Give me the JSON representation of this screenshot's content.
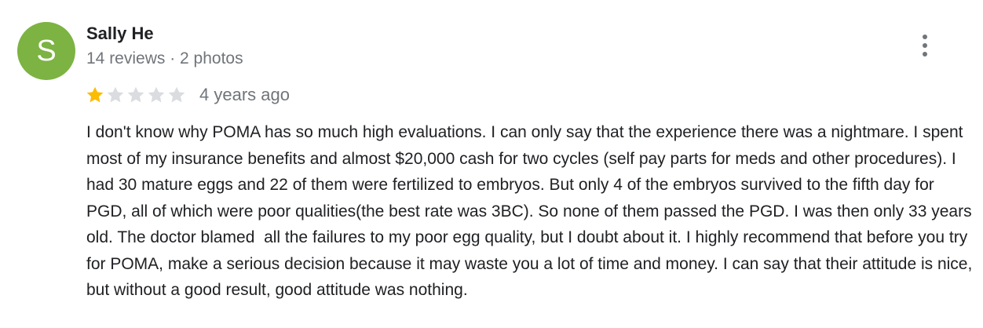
{
  "review": {
    "avatar_letter": "S",
    "avatar_color": "#7cb342",
    "author_name": "Sally He",
    "author_meta": "14 reviews · 2 photos",
    "rating": 1,
    "rating_max": 5,
    "star_filled_color": "#fbbc04",
    "star_empty_color": "#dadce0",
    "time_ago": "4 years ago",
    "more_icon": "more-vertical-icon",
    "text": "I don't know why POMA has so much high evaluations. I can only say that the experience there was a nightmare. I spent most of my insurance benefits and almost $20,000 cash for two cycles (self pay parts for meds and other procedures). I had 30 mature eggs and 22 of them were fertilized to embryos. But only 4 of the embryos survived to the fifth day for PGD, all of which were poor qualities(the best rate was 3BC). So none of them passed the PGD. I was then only 33 years old. The doctor blamed  all the failures to my poor egg quality, but I doubt about it. I highly recommend that before you try for POMA, make a serious decision because it may waste you a lot of time and money. I can say that their attitude is nice, but without a good result, good attitude was nothing."
  }
}
